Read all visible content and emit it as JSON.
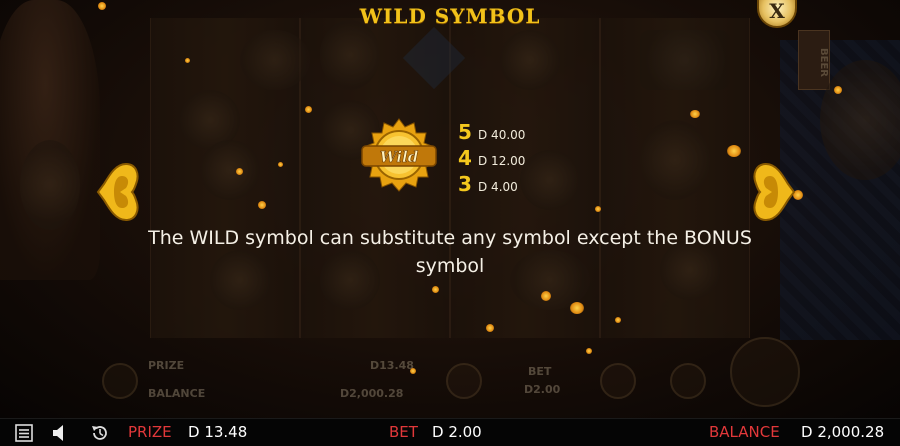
{
  "popup": {
    "title": "WILD SYMBOL",
    "close_label": "X",
    "badge_text": "Wild",
    "paytable": [
      {
        "count": "5",
        "value": "D 40.00"
      },
      {
        "count": "4",
        "value": "D 12.00"
      },
      {
        "count": "3",
        "value": "D 4.00"
      }
    ],
    "description": "The WILD symbol can substitute any symbol except the BONUS symbol"
  },
  "background": {
    "sign_text": "BEER",
    "panel": {
      "prize_label": "PRIZE",
      "prize_value": "D13.48",
      "balance_label": "BALANCE",
      "balance_value": "D2,000.28",
      "bet_label": "BET",
      "bet_value": "D2.00"
    }
  },
  "bottom_bar": {
    "prize_label": "PRIZE",
    "prize_value": "D 13.48",
    "bet_label": "BET",
    "bet_value": "D 2.00",
    "balance_label": "BALANCE",
    "balance_value": "D 2,000.28"
  },
  "colors": {
    "gold": "#f2c21a",
    "label_red": "#e2383a",
    "text_white": "#f5f0e6"
  },
  "icons": [
    "menu-icon",
    "sound-icon",
    "history-icon",
    "close-icon",
    "heart-arrow-left-icon",
    "heart-arrow-right-icon"
  ]
}
